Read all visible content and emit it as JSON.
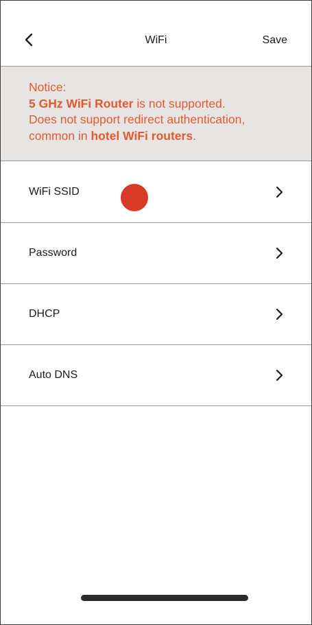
{
  "header": {
    "title": "WiFi",
    "save_label": "Save",
    "back_icon": "chevron-left-icon"
  },
  "notice": {
    "line1": "Notice:",
    "line2_bold": "5 GHz WiFi Router",
    "line2_rest": " is not supported.",
    "line3": "Does not support redirect authentication,",
    "line4_prefix": "common in ",
    "line4_bold": "hotel WiFi routers",
    "line4_suffix": ".",
    "color": "#e2592e",
    "background": "#e7e5e3"
  },
  "settings": {
    "items": [
      {
        "label": "WiFi SSID",
        "icon": "chevron-right-icon"
      },
      {
        "label": "Password",
        "icon": "chevron-right-icon"
      },
      {
        "label": "DHCP",
        "icon": "chevron-right-icon"
      },
      {
        "label": "Auto DNS",
        "icon": "chevron-right-icon"
      }
    ]
  },
  "touch_indicator": {
    "color": "#d83a28"
  }
}
